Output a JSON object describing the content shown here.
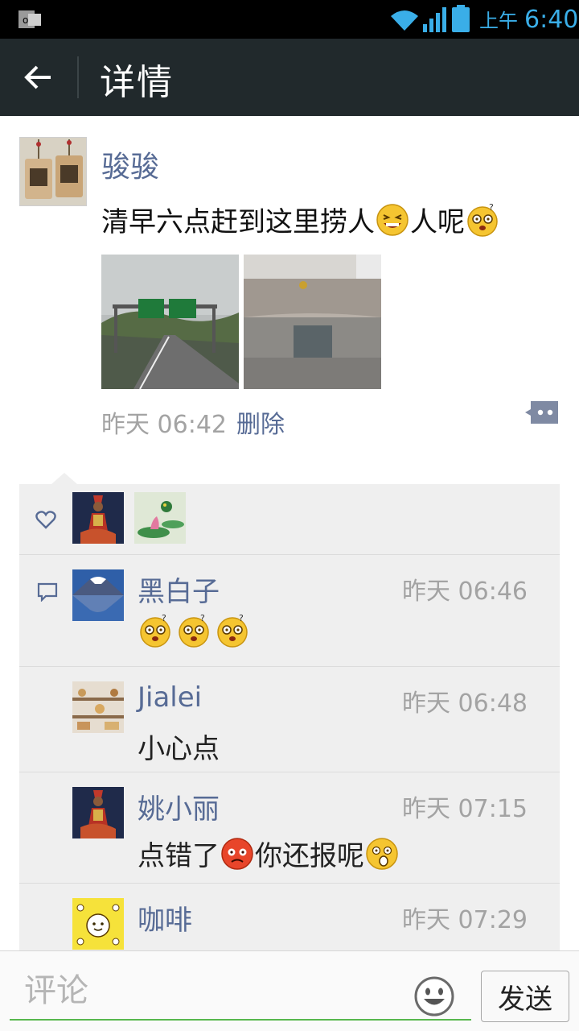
{
  "status_bar": {
    "time": "6:40",
    "ampm": "上午",
    "icons": [
      "outlook-notification-icon",
      "wifi-icon",
      "signal-icon",
      "battery-icon"
    ]
  },
  "header": {
    "title": "详情",
    "back_icon": "arrow-left-icon"
  },
  "post": {
    "author": "骏骏",
    "text_part1": "清早六点赶到这里捞人",
    "text_part2": "人呢",
    "emojis": [
      "laughing-emoji",
      "dizzy-emoji"
    ],
    "time": "昨天 06:42",
    "delete_label": "删除",
    "photos": [
      "highway-road-photo",
      "building-entrance-photo"
    ]
  },
  "likes": {
    "icon": "heart-icon",
    "avatars": [
      "dancer-avatar",
      "lotus-pond-avatar"
    ]
  },
  "comments": [
    {
      "name": "黑白子",
      "time": "昨天 06:46",
      "text": "",
      "emojis": [
        "dizzy-emoji",
        "dizzy-emoji",
        "dizzy-emoji"
      ]
    },
    {
      "name": "Jialei",
      "time": "昨天 06:48",
      "text": "小心点",
      "emojis": []
    },
    {
      "name": "姚小丽",
      "time": "昨天 07:15",
      "text_part1": "点错了",
      "text_part2": "你还报呢",
      "emojis": [
        "angry-emoji",
        "surprised-emoji"
      ]
    },
    {
      "name": "咖啡",
      "time": "昨天 07:29",
      "text": "",
      "emojis": []
    }
  ],
  "input": {
    "placeholder": "评论",
    "send_label": "发送"
  },
  "colors": {
    "name_blue": "#576b95",
    "title_bar": "#21292c",
    "accent_green": "#58b84e",
    "status_blue": "#3aaee8"
  }
}
